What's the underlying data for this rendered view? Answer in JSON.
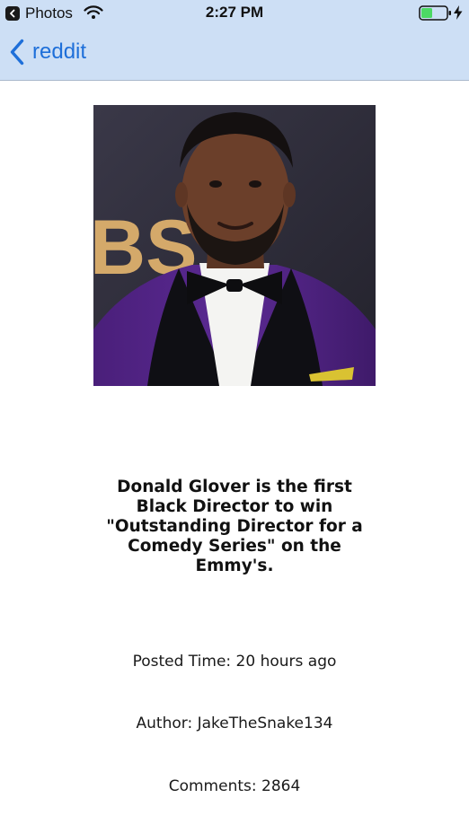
{
  "status_bar": {
    "back_app_label": "Photos",
    "time": "2:27 PM",
    "battery_color": "#4cd964"
  },
  "nav": {
    "back_label": "reddit",
    "accent_color": "#1e6fd9"
  },
  "post": {
    "image_icon": "post-photo",
    "title": "Donald Glover is the first Black Director to win \"Outstanding Director for a Comedy Series\" on the Emmy's.",
    "posted_time_label": "Posted Time: ",
    "posted_time_value": "20 hours ago",
    "author_label": "Author: ",
    "author_value": "JakeTheSnake134",
    "comments_label": "Comments: ",
    "comments_value": "2864"
  }
}
